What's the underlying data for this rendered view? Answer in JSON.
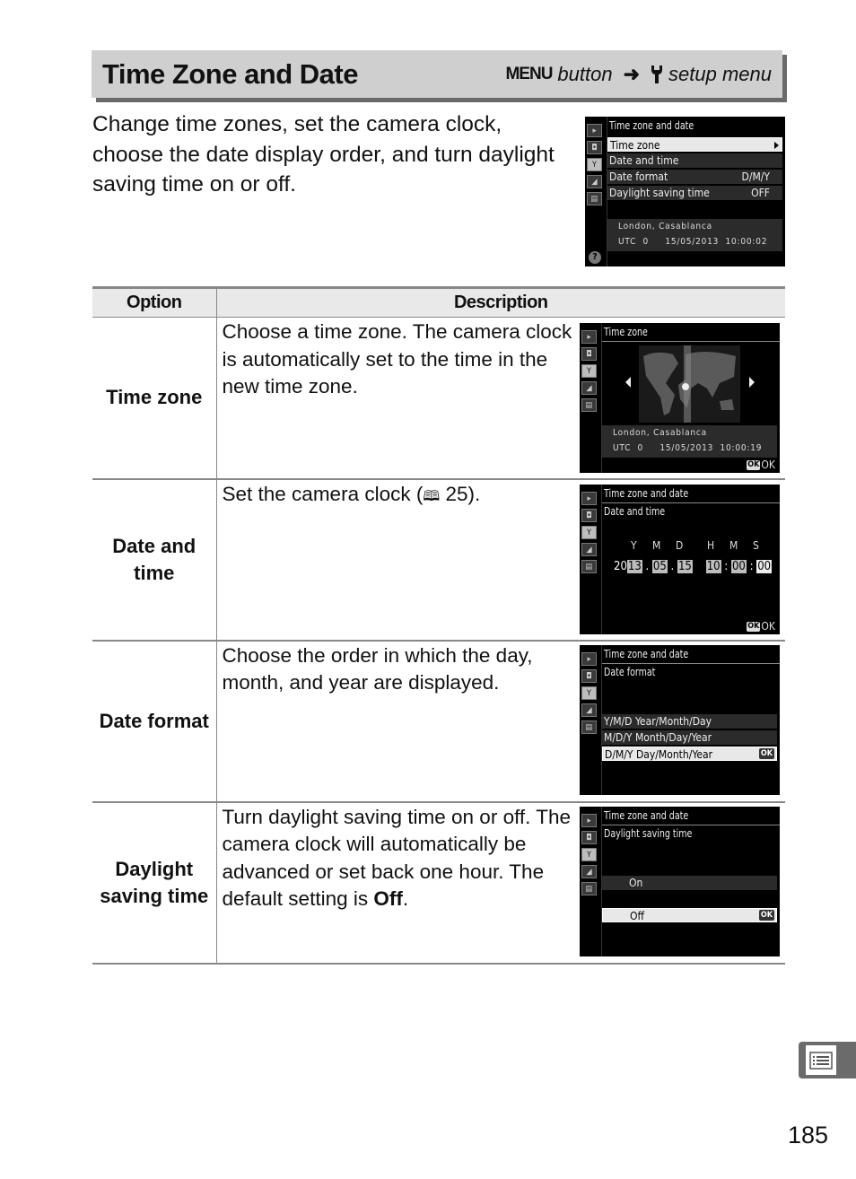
{
  "header": {
    "title": "Time Zone and Date",
    "menu_word": "MENU",
    "button_word": "button",
    "arrow": "➜",
    "setup_menu": "setup menu"
  },
  "intro": "Change time zones, set the camera clock, choose the date display order, and turn daylight saving time on or off.",
  "main_screen": {
    "title": "Time zone and date",
    "items": [
      {
        "label": "Time zone",
        "value": "",
        "selected": true
      },
      {
        "label": "Date and time",
        "value": ""
      },
      {
        "label": "Date format",
        "value": "D/M/Y"
      },
      {
        "label": "Daylight saving time",
        "value": "OFF"
      }
    ],
    "location": "London, Casablanca",
    "utc": "UTC  0",
    "datetime": "15/05/2013  10:00:02",
    "help": "?"
  },
  "table": {
    "headers": [
      "Option",
      "Description"
    ],
    "rows": [
      {
        "option": "Time zone",
        "description": "Choose a time zone.  The camera clock is automatically set to the time in the new time zone.",
        "screen": {
          "title": "Time zone",
          "location": "London, Casablanca",
          "utc": "UTC  0",
          "datetime": "15/05/2013  10:00:19",
          "ok": "OK"
        }
      },
      {
        "option": "Date and time",
        "description_prefix": "Set the camera clock (",
        "page_ref_icon": "book-icon",
        "page_ref": "25",
        "description_suffix": ").",
        "screen": {
          "title": "Time zone and date",
          "subtitle": "Date and time",
          "labels": [
            "Y",
            "M",
            "D",
            "H",
            "M",
            "S"
          ],
          "year_prefix": "20",
          "year": "13",
          "month": "05",
          "day": "15",
          "hour": "10",
          "minute": "00",
          "second": "00",
          "ok": "OK"
        }
      },
      {
        "option": "Date format",
        "description": "Choose the order in which the day, month, and year are displayed.",
        "screen": {
          "title": "Time zone and date",
          "subtitle": "Date format",
          "items": [
            {
              "code": "Y/M/D",
              "label": "Year/Month/Day"
            },
            {
              "code": "M/D/Y",
              "label": "Month/Day/Year"
            },
            {
              "code": "D/M/Y",
              "label": "Day/Month/Year",
              "selected": true
            }
          ],
          "ok": "OK"
        }
      },
      {
        "option": "Daylight saving time",
        "description_prefix": "Turn daylight saving time on or off. The camera clock will automatically be advanced or set back one hour. The default setting is ",
        "description_bold": "Off",
        "description_suffix": ".",
        "screen": {
          "title": "Time zone and date",
          "subtitle": "Daylight saving time",
          "items": [
            {
              "label": "On"
            },
            {
              "label": "Off",
              "selected": true
            }
          ],
          "ok": "OK"
        }
      }
    ]
  },
  "side_tab_icon": "menu-list-icon",
  "page_number": "185"
}
